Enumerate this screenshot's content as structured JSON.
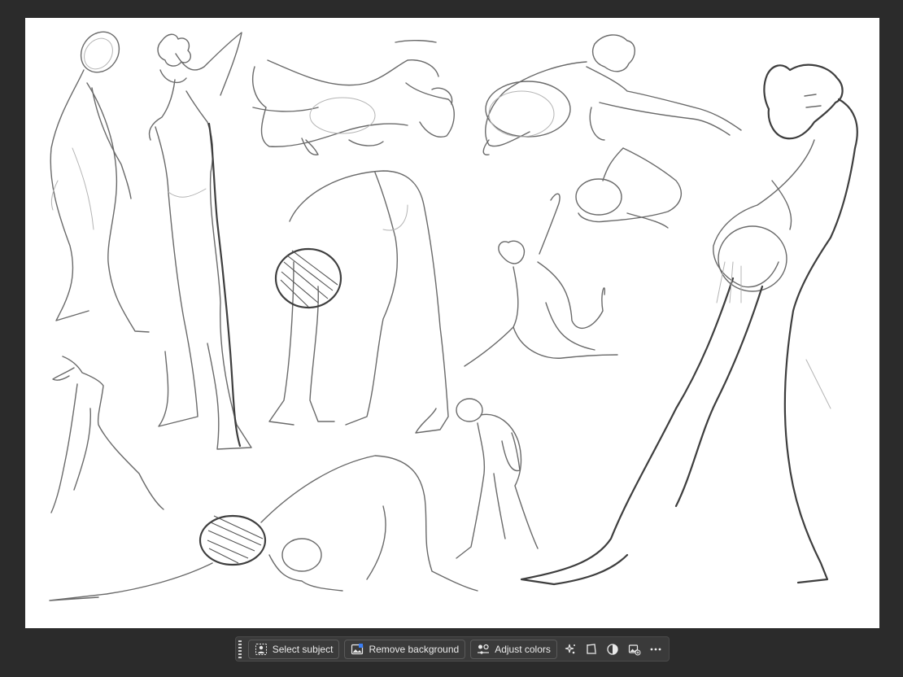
{
  "canvas": {
    "content": "figure gesture sketches"
  },
  "taskbar": {
    "select_subject_label": "Select subject",
    "remove_background_label": "Remove background",
    "adjust_colors_label": "Adjust colors",
    "tools": [
      {
        "icon": "sparkle-dots-icon"
      },
      {
        "icon": "crop-transform-icon"
      },
      {
        "icon": "half-circle-contrast-icon"
      },
      {
        "icon": "image-add-icon"
      },
      {
        "icon": "more-ellipsis-icon"
      }
    ]
  }
}
